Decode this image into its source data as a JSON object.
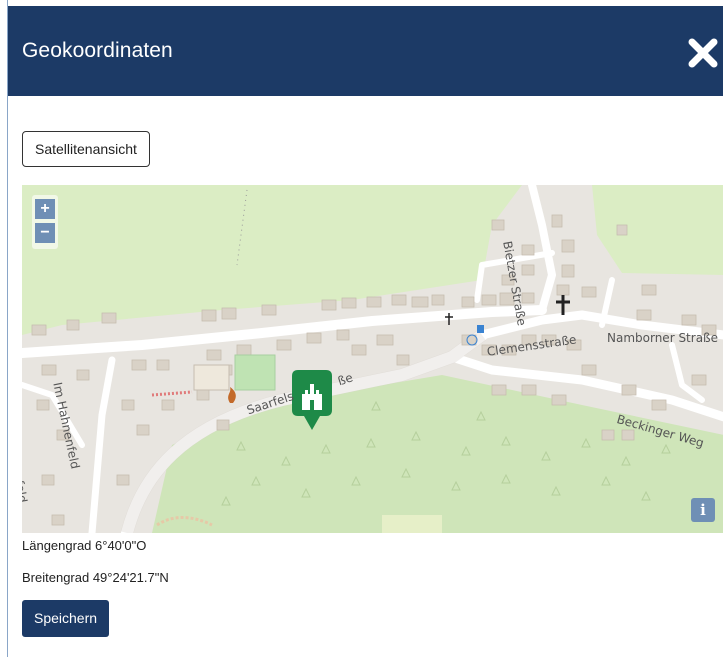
{
  "dialog": {
    "title": "Geokoordinaten",
    "close_icon": "close-x-icon"
  },
  "map": {
    "view_toggle_label": "Satellitenansicht",
    "zoom_in_label": "+",
    "zoom_out_label": "−",
    "info_label": "i",
    "streets": {
      "bietzer": "Bietzer Straße",
      "namborner": "Namborner Straße",
      "clemens": "Clemensstraße",
      "saarfels": "Saarfels",
      "saarfels_suffix": "ße",
      "beckinger": "Beckinger Weg",
      "hahnenfeld": "Im Hahnenfeld",
      "hahnenfeld_partial": "nenfeld"
    },
    "marker_icon": "castle-marker-icon",
    "colors": {
      "marker": "#1e8a48",
      "forest": "#cfe5b9",
      "meadow": "#dbedc4",
      "road": "#ffffff",
      "building": "#d8d2c8"
    }
  },
  "coordinates": {
    "longitude": "Längengrad 6°40'0\"O",
    "latitude": "Breitengrad 49°24'21.7\"N"
  },
  "actions": {
    "save_label": "Speichern"
  },
  "colors": {
    "header_bg": "#1c3a66",
    "button_bg": "#1c3a66"
  }
}
